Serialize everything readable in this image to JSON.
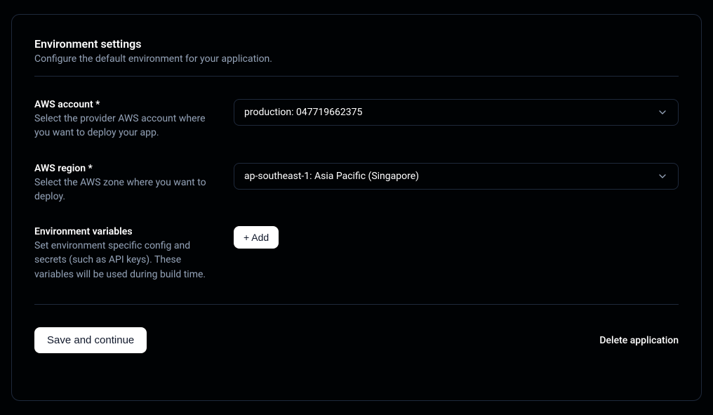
{
  "header": {
    "title": "Environment settings",
    "subtitle": "Configure the default environment for your application."
  },
  "fields": {
    "account": {
      "label": "AWS account *",
      "description": "Select the provider AWS account where you want to deploy your app.",
      "value": "production: 047719662375"
    },
    "region": {
      "label": "AWS region *",
      "description": "Select the AWS zone where you want to deploy.",
      "value": "ap-southeast-1: Asia Pacific (Singapore)"
    },
    "envvars": {
      "label": "Environment variables",
      "description": "Set environment specific config and secrets (such as API keys). These variables will be used during build time.",
      "add_label": "+ Add"
    }
  },
  "actions": {
    "save": "Save and continue",
    "delete": "Delete application"
  }
}
